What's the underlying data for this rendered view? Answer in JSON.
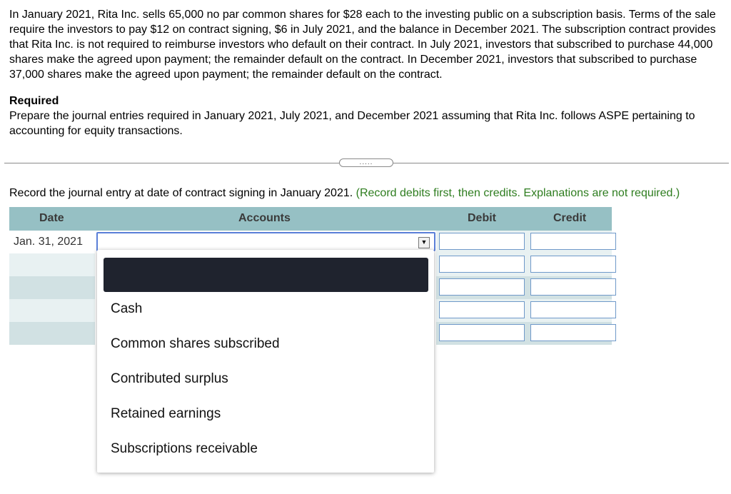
{
  "problem": {
    "paragraph": "In January 2021, Rita Inc. sells 65,000 no par common shares for $28 each to the investing public on a subscription basis. Terms of the sale require the investors to pay $12 on contract signing, $6 in July 2021, and the balance in December 2021. The subscription contract provides that Rita Inc. is not required to reimburse investors who default on their contract. In July 2021, investors that subscribed to purchase 44,000 shares make the agreed upon payment; the remainder default on the contract. In December 2021, investors that subscribed to purchase 37,000 shares make the agreed upon payment; the remainder default on the contract.",
    "required_heading": "Required",
    "required_text": "Prepare the journal entries required in January 2021, July 2021, and December 2021 assuming that Rita Inc. follows ASPE pertaining to accounting for equity transactions."
  },
  "expand_button": {
    "label": "....."
  },
  "instruction": {
    "main": "Record the journal entry at date of contract signing in January 2021.",
    "note": "(Record debits first, then credits. Explanations are not required.)"
  },
  "table": {
    "headers": {
      "date": "Date",
      "accounts": "Accounts",
      "debit": "Debit",
      "credit": "Credit"
    },
    "first_row_date": "Jan. 31,  2021"
  },
  "dropdown": {
    "options": [
      "Cash",
      "Common shares subscribed",
      "Contributed surplus",
      "Retained earnings",
      "Subscriptions receivable"
    ]
  },
  "colors": {
    "header_bg": "#96c0c4",
    "note_green": "#2e7d1f",
    "select_border": "#5a7fd8",
    "highlight_bg": "#1f232e"
  }
}
